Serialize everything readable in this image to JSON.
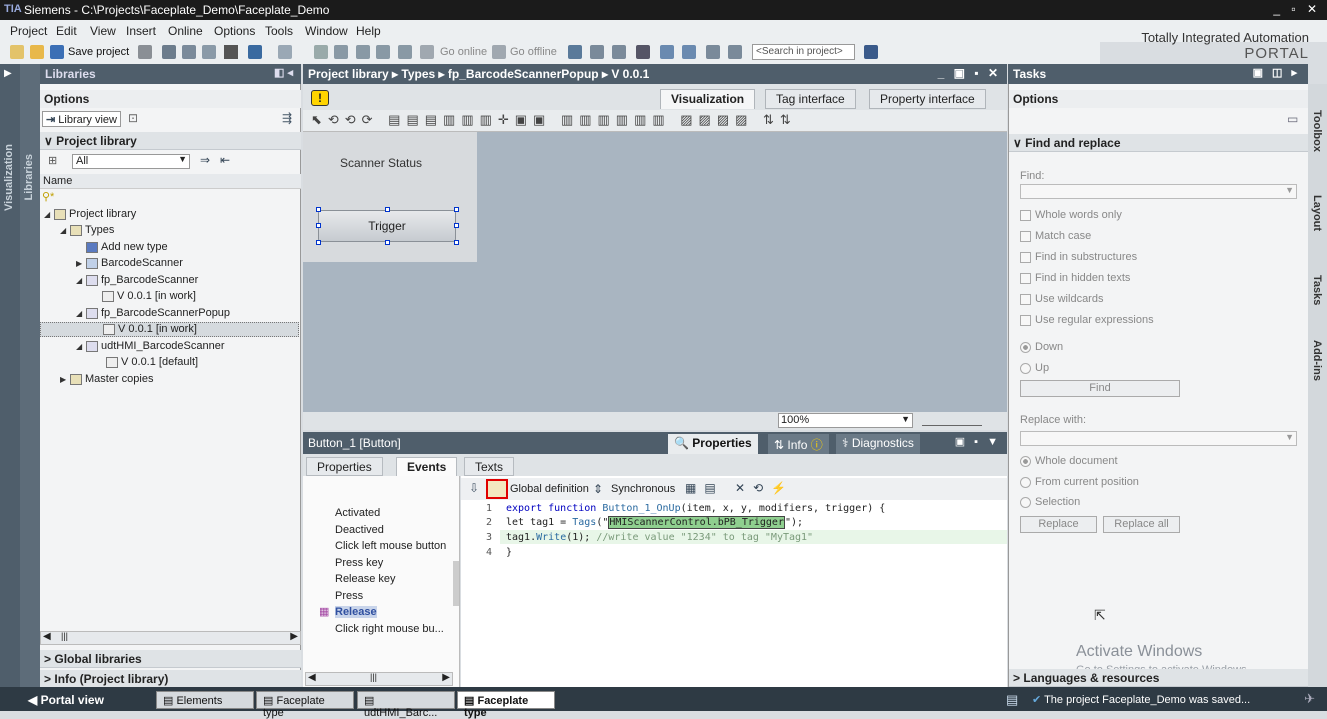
{
  "window": {
    "title": "Siemens - C:\\Projects\\Faceplate_Demo\\Faceplate_Demo",
    "logo": "TIA",
    "controls": "_ ▫ ✕"
  },
  "menu": [
    "Project",
    "Edit",
    "View",
    "Insert",
    "Online",
    "Options",
    "Tools",
    "Window",
    "Help"
  ],
  "brand": {
    "line1": "Totally Integrated Automation",
    "line2": "PORTAL"
  },
  "toolbar": {
    "save_project": "Save project",
    "go_online": "Go online",
    "go_offline": "Go offline",
    "search_placeholder": "<Search in project>"
  },
  "left_bars": {
    "visualization": "Visualization",
    "libraries": "Libraries"
  },
  "libraries": {
    "title": "Libraries",
    "options": "Options",
    "library_view": "Library view",
    "project_library": "Project library",
    "filter_value": "All",
    "column_name": "Name",
    "tree": [
      {
        "label": "Project library"
      },
      {
        "label": "Types"
      },
      {
        "label": "Add new type"
      },
      {
        "label": "BarcodeScanner"
      },
      {
        "label": "fp_BarcodeScanner"
      },
      {
        "label": "V 0.0.1 [in work]"
      },
      {
        "label": "fp_BarcodeScannerPopup"
      },
      {
        "label": "V 0.0.1 [in work]"
      },
      {
        "label": "udtHMI_BarcodeScanner"
      },
      {
        "label": "V 0.0.1 [default]"
      },
      {
        "label": "Master copies"
      }
    ],
    "global_libraries": "Global libraries",
    "info": "Info (Project library)"
  },
  "editor": {
    "breadcrumb": [
      "Project library",
      "Types",
      "fp_BarcodeScannerPopup",
      "V 0.0.1"
    ],
    "tabs": [
      "Visualization",
      "Tag interface",
      "Property interface"
    ],
    "scanner_status": "Scanner Status",
    "trigger": "Trigger",
    "zoom": "100%"
  },
  "properties": {
    "object": "Button_1 [Button]",
    "tabs": [
      "Properties",
      "Info",
      "Diagnostics"
    ],
    "subtabs": [
      "Properties",
      "Events",
      "Texts"
    ],
    "events": [
      "Activated",
      "Deactived",
      "Click left mouse button",
      "Press key",
      "Release key",
      "Press",
      "Release",
      "Click right mouse bu..."
    ],
    "global_definition": "Global definition",
    "synchronous": "Synchronous",
    "code": {
      "l1_kw": "export function ",
      "l1_fn": "Button_1_OnUp",
      "l1_rest": "(item, x, y, modifiers, trigger) {",
      "l2_a": "let tag1 = ",
      "l2_fn": "Tags",
      "l2_b": "(\"",
      "l2_hl": "HMIScannerControl.bPB_Trigger",
      "l2_c": "\");",
      "l3_a": "tag1.",
      "l3_fn": "Write",
      "l3_b": "(1); ",
      "l3_cmt": "//write value \"1234\" to tag \"MyTag1\"",
      "l4": "}"
    },
    "line_numbers": [
      "1",
      "2",
      "3",
      "4"
    ]
  },
  "tasks": {
    "title": "Tasks",
    "options": "Options",
    "find_replace": "Find and replace",
    "find_label": "Find:",
    "checkboxes": [
      "Whole words only",
      "Match case",
      "Find in substructures",
      "Find in hidden texts",
      "Use wildcards",
      "Use regular expressions"
    ],
    "dir": [
      "Down",
      "Up"
    ],
    "find_btn": "Find",
    "replace_with": "Replace with:",
    "scope": [
      "Whole document",
      "From current position",
      "Selection"
    ],
    "replace_btn": "Replace",
    "replace_all_btn": "Replace all",
    "languages": "Languages & resources"
  },
  "right_tabs": [
    "Toolbox",
    "Layout",
    "Tasks",
    "Add-ins"
  ],
  "watermark": {
    "line1": "Activate Windows",
    "line2": "Go to Settings to activate Windows."
  },
  "statusbar": {
    "portal_view": "Portal view",
    "tabs": [
      "Elements",
      "Faceplate type",
      "udtHMI_Barc...",
      "Faceplate type"
    ],
    "message": "The project Faceplate_Demo was saved..."
  }
}
